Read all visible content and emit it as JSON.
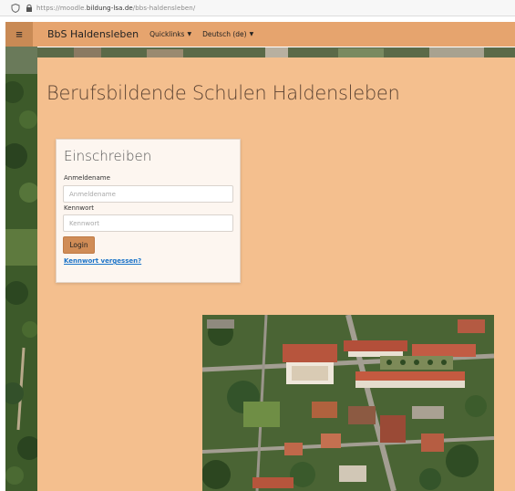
{
  "browser": {
    "url_prefix": "https://moodle.",
    "url_domain": "bildung-lsa.de",
    "url_path": "/bbs-haldensleben/"
  },
  "navbar": {
    "site_name": "BbS Haldensleben",
    "quicklinks_label": "Quicklinks",
    "language_label": "Deutsch (de)"
  },
  "page": {
    "title": "Berufsbildende Schulen Haldensleben"
  },
  "login": {
    "title": "Einschreiben",
    "username_label": "Anmeldename",
    "username_placeholder": "Anmeldename",
    "password_label": "Kennwort",
    "password_placeholder": "Kennwort",
    "submit_label": "Login",
    "forgot_link": "Kennwort vergessen?"
  },
  "colors": {
    "navbar": "#e6a46e",
    "menu_button": "#c98a55",
    "main_background": "#f4bf8e",
    "card_background": "#fdf6f0",
    "button": "#d08c56",
    "link": "#1a73c8"
  }
}
